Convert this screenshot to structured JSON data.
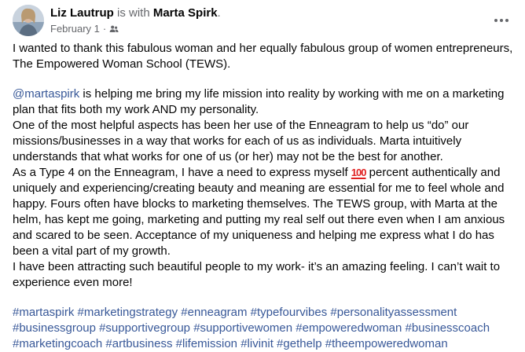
{
  "header": {
    "author": "Liz Lautrup",
    "with_text": " is with ",
    "tagged": "Marta Spirk",
    "period": ".",
    "date": "February 1",
    "separator": "·",
    "audience_icon": "friends-icon",
    "more_icon": "more-options-icon"
  },
  "body": {
    "para1": "I wanted to thank this fabulous woman and her equally fabulous group of women entrepreneurs, The Empowered Woman School (TEWS).",
    "mention": "@martaspirk",
    "para2_rest": " is helping me bring my life mission into reality by working with me on a marketing plan that fits both my work AND my personality.",
    "para3": "One of the most helpful aspects has been her use of the Enneagram to help us “do” our missions/businesses in a way that works for each of us as individuals. Marta intuitively understands that what works for one of us (or her) may not be the best for another.",
    "para4_start": "As a Type 4 on the Enneagram, I have a need to express myself ",
    "emoji": "100",
    "para4_rest": " percent authentically and uniquely and experiencing/creating beauty and meaning are essential for me to feel whole and happy. Fours often have blocks to marketing themselves. The TEWS group, with Marta at the helm, has kept me going, marketing and putting my real self out there even when I am anxious and scared to be seen. Acceptance of my uniqueness and helping me express what I do has been a vital part of my growth.",
    "para5": "I have been attracting such beautiful people to my work- it’s an amazing feeling. I can’t wait to experience even more!"
  },
  "hashtags": [
    "#martaspirk",
    "#marketingstrategy",
    "#enneagram",
    "#typefourvibes",
    "#personalityassessment",
    "#businessgroup",
    "#supportivegroup",
    "#supportivewomen",
    "#empoweredwoman",
    "#businesscoach",
    "#marketingcoach",
    "#artbusiness",
    "#lifemission",
    "#livinit",
    "#gethelp",
    "#theempoweredwoman"
  ],
  "colors": {
    "link": "#385898",
    "secondary_text": "#65676b",
    "primary_text": "#050505"
  }
}
